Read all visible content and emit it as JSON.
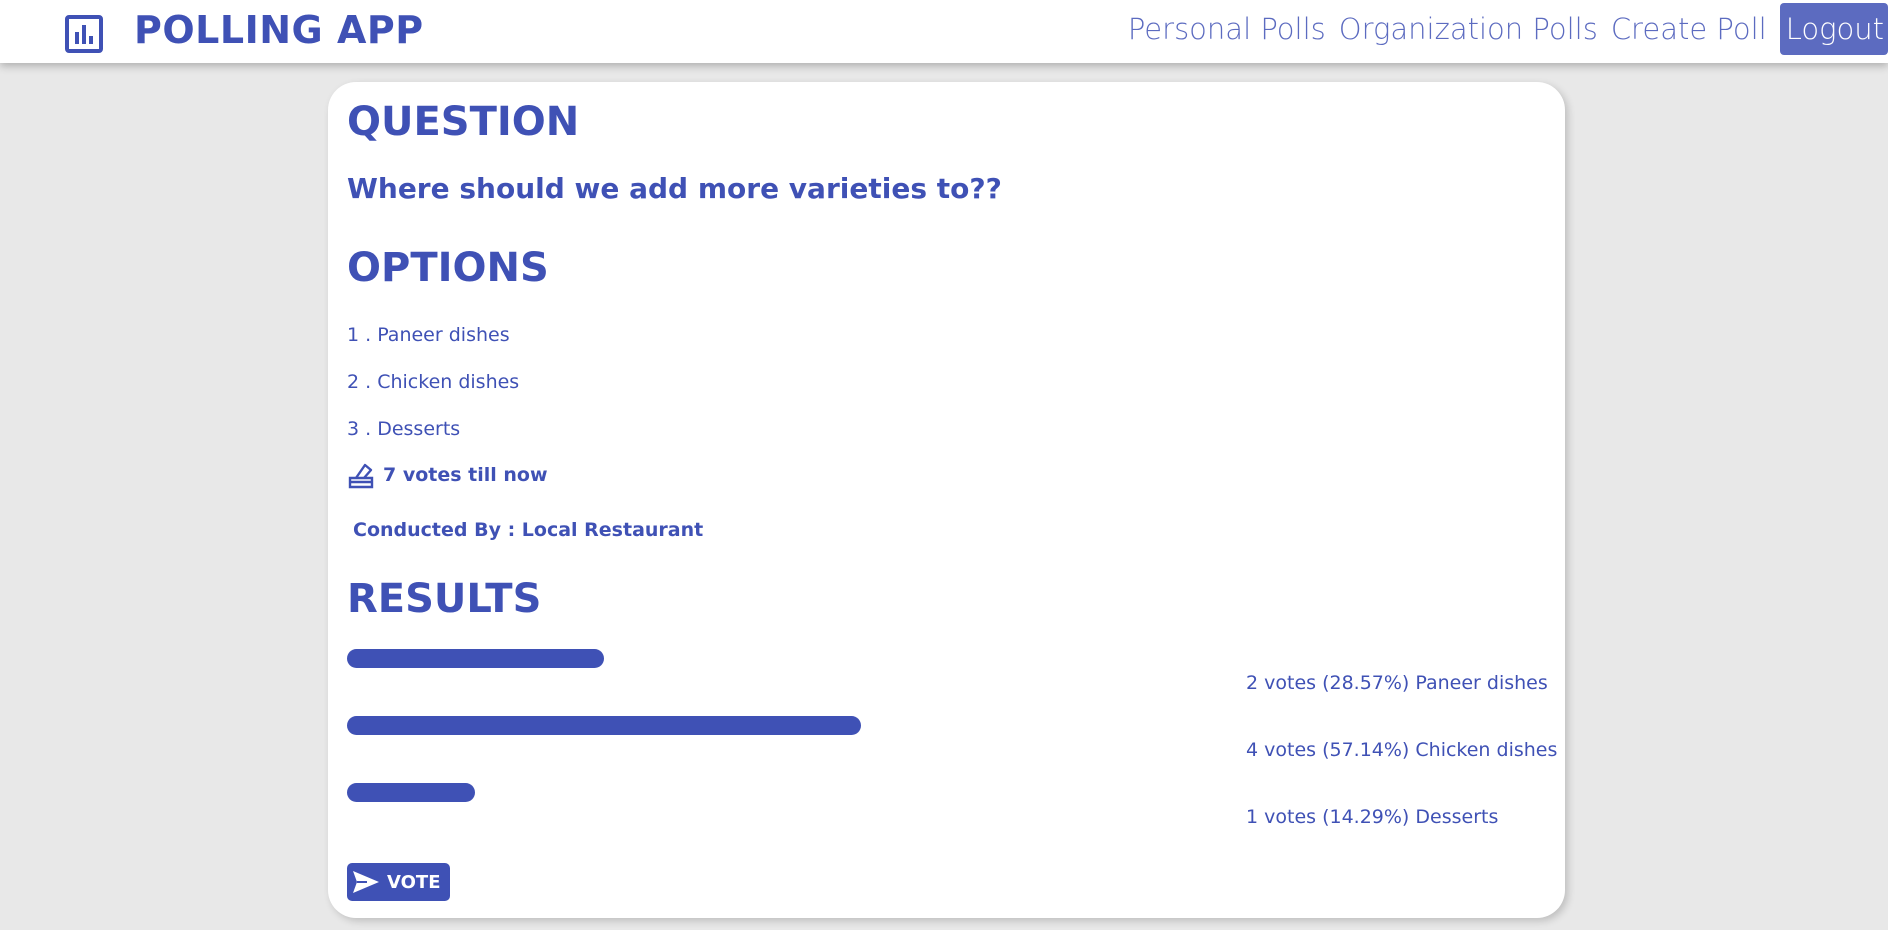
{
  "app": {
    "title": "POLLING APP",
    "icon": "bar-chart-icon"
  },
  "nav": {
    "personal_polls": "Personal Polls",
    "organization_polls": "Organization Polls",
    "create_poll": "Create Poll",
    "logout": "Logout"
  },
  "poll": {
    "question_heading": "QUESTION",
    "question": "Where should we add more varieties to??",
    "options_heading": "OPTIONS",
    "options": [
      "1 . Paneer dishes",
      "2 . Chicken dishes",
      "3 . Desserts"
    ],
    "votes_icon": "ballot-box-icon",
    "votes_text": "7 votes till now",
    "conducted_by": "Conducted By : Local Restaurant",
    "results_heading": "RESULTS",
    "results": [
      {
        "label": "2 votes (28.57%) Paneer dishes",
        "votes": 2,
        "percent": 28.57
      },
      {
        "label": "4 votes (57.14%) Chicken dishes",
        "votes": 4,
        "percent": 57.14
      },
      {
        "label": "1 votes (14.29%) Desserts",
        "votes": 1,
        "percent": 14.29
      }
    ],
    "vote_button": "VOTE",
    "vote_icon": "send-icon"
  },
  "colors": {
    "primary": "#3f51b5",
    "nav_link": "#5c6bc0",
    "background": "#e8e8e8"
  }
}
